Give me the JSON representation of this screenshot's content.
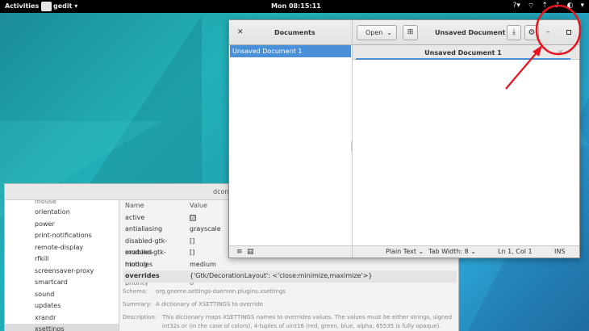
{
  "topbar": {
    "activities": "Activities",
    "app_name": "gedit",
    "app_caret": "▾",
    "clock": "Mon 08:15:11",
    "indicators": [
      "?▾",
      "▾",
      "⇡",
      "♪",
      "◐"
    ],
    "power_caret": "▾"
  },
  "dconf": {
    "title": "dconf",
    "tree_top": "mouse",
    "tree_items": [
      "orientation",
      "power",
      "print-notifications",
      "remote-display",
      "rfkill",
      "screensaver-proxy",
      "smartcard",
      "sound",
      "updates",
      "xrandr",
      "xsettings"
    ],
    "selected_tree_item": "xsettings",
    "columns": {
      "name": "Name",
      "value": "Value"
    },
    "rows": [
      {
        "name": "active",
        "value": "☑"
      },
      {
        "name": "antialiasing",
        "value": "grayscale"
      },
      {
        "name": "disabled-gtk-modules",
        "value": "[]"
      },
      {
        "name": "enabled-gtk-modules",
        "value": "[]"
      },
      {
        "name": "hinting",
        "value": "medium"
      },
      {
        "name": "overrides",
        "value": "{'Gtk/DecorationLayout': <'close:minimize,maximize'>}"
      }
    ],
    "row_partial": {
      "name": "priority",
      "value": "0"
    },
    "info": {
      "schema_label": "Schema:",
      "schema": "org.gnome.settings-daemon.plugins.xsettings",
      "summary_label": "Summary:",
      "summary": "A dictionary of XSETTINGS to override",
      "description_label": "Description:",
      "description": "This dictionary maps XSETTINGS names to overrides values. The values must be either strings, signed int32s or (in the case of colors), 4-tuples of uint16 (red, green, blue, alpha; 65535 is fully opaque)."
    }
  },
  "gedit": {
    "close_glyph": "✕",
    "documents_title": "Documents",
    "open_label": "Open",
    "open_caret": "⌄",
    "pin_glyph": "⊞",
    "title": "Unsaved Document 1",
    "save_glyph": "⤓",
    "gear_glyph": "⚙",
    "min_glyph": "–",
    "doc_list": [
      "Unsaved Document 1"
    ],
    "tab_label": "Unsaved Document 1",
    "tab_close": "✕",
    "sidebar_footer": [
      "≡",
      "▤"
    ],
    "status": {
      "language": "Plain Text ⌄",
      "tab_width": "Tab Width: 8 ⌄",
      "position": "Ln 1, Col 1",
      "mode": "INS"
    }
  },
  "annotation": {
    "color": "#e8121e"
  },
  "colors": {
    "selection": "#4a90d9",
    "topbar": "#000000"
  }
}
